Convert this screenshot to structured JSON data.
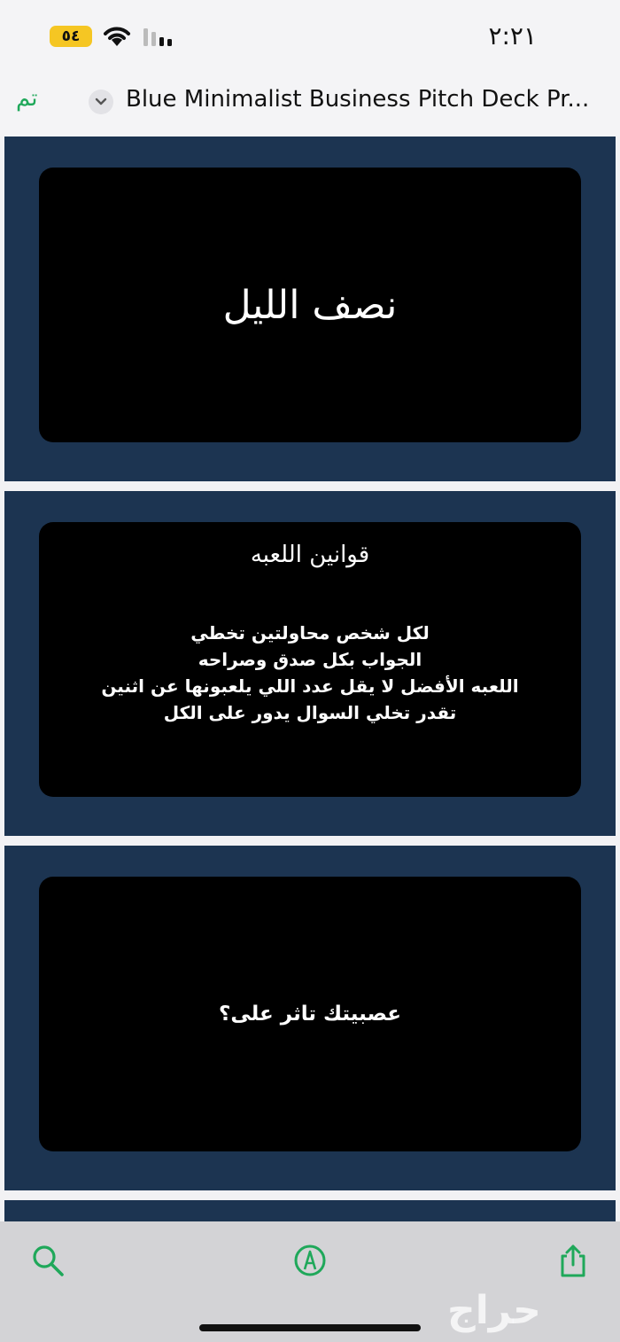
{
  "status_bar": {
    "battery": "٥٤",
    "time": "٢:٢١"
  },
  "nav": {
    "done_label": "تم",
    "title": "Blue Minimalist Business Pitch Deck Pr..."
  },
  "slides": [
    {
      "title": "نصف الليل"
    },
    {
      "title": "قوانين اللعبه",
      "rules": [
        "لكل شخص محاولتين تخطي",
        "الجواب بكل صدق وصراحه",
        "اللعبه الأفضل لا يقل عدد اللي يلعبونها عن اثنين",
        "تقدر تخلي السوال يدور على الكل"
      ]
    },
    {
      "title": "عصبيتك تاثر على؟"
    }
  ],
  "watermark": "حراج",
  "colors": {
    "accent": "#1fa85a",
    "slide_background": "#1c3451",
    "card_background": "#000000"
  },
  "icons": {
    "search": "search-icon",
    "markup": "markup-pen-icon",
    "share": "share-icon"
  }
}
